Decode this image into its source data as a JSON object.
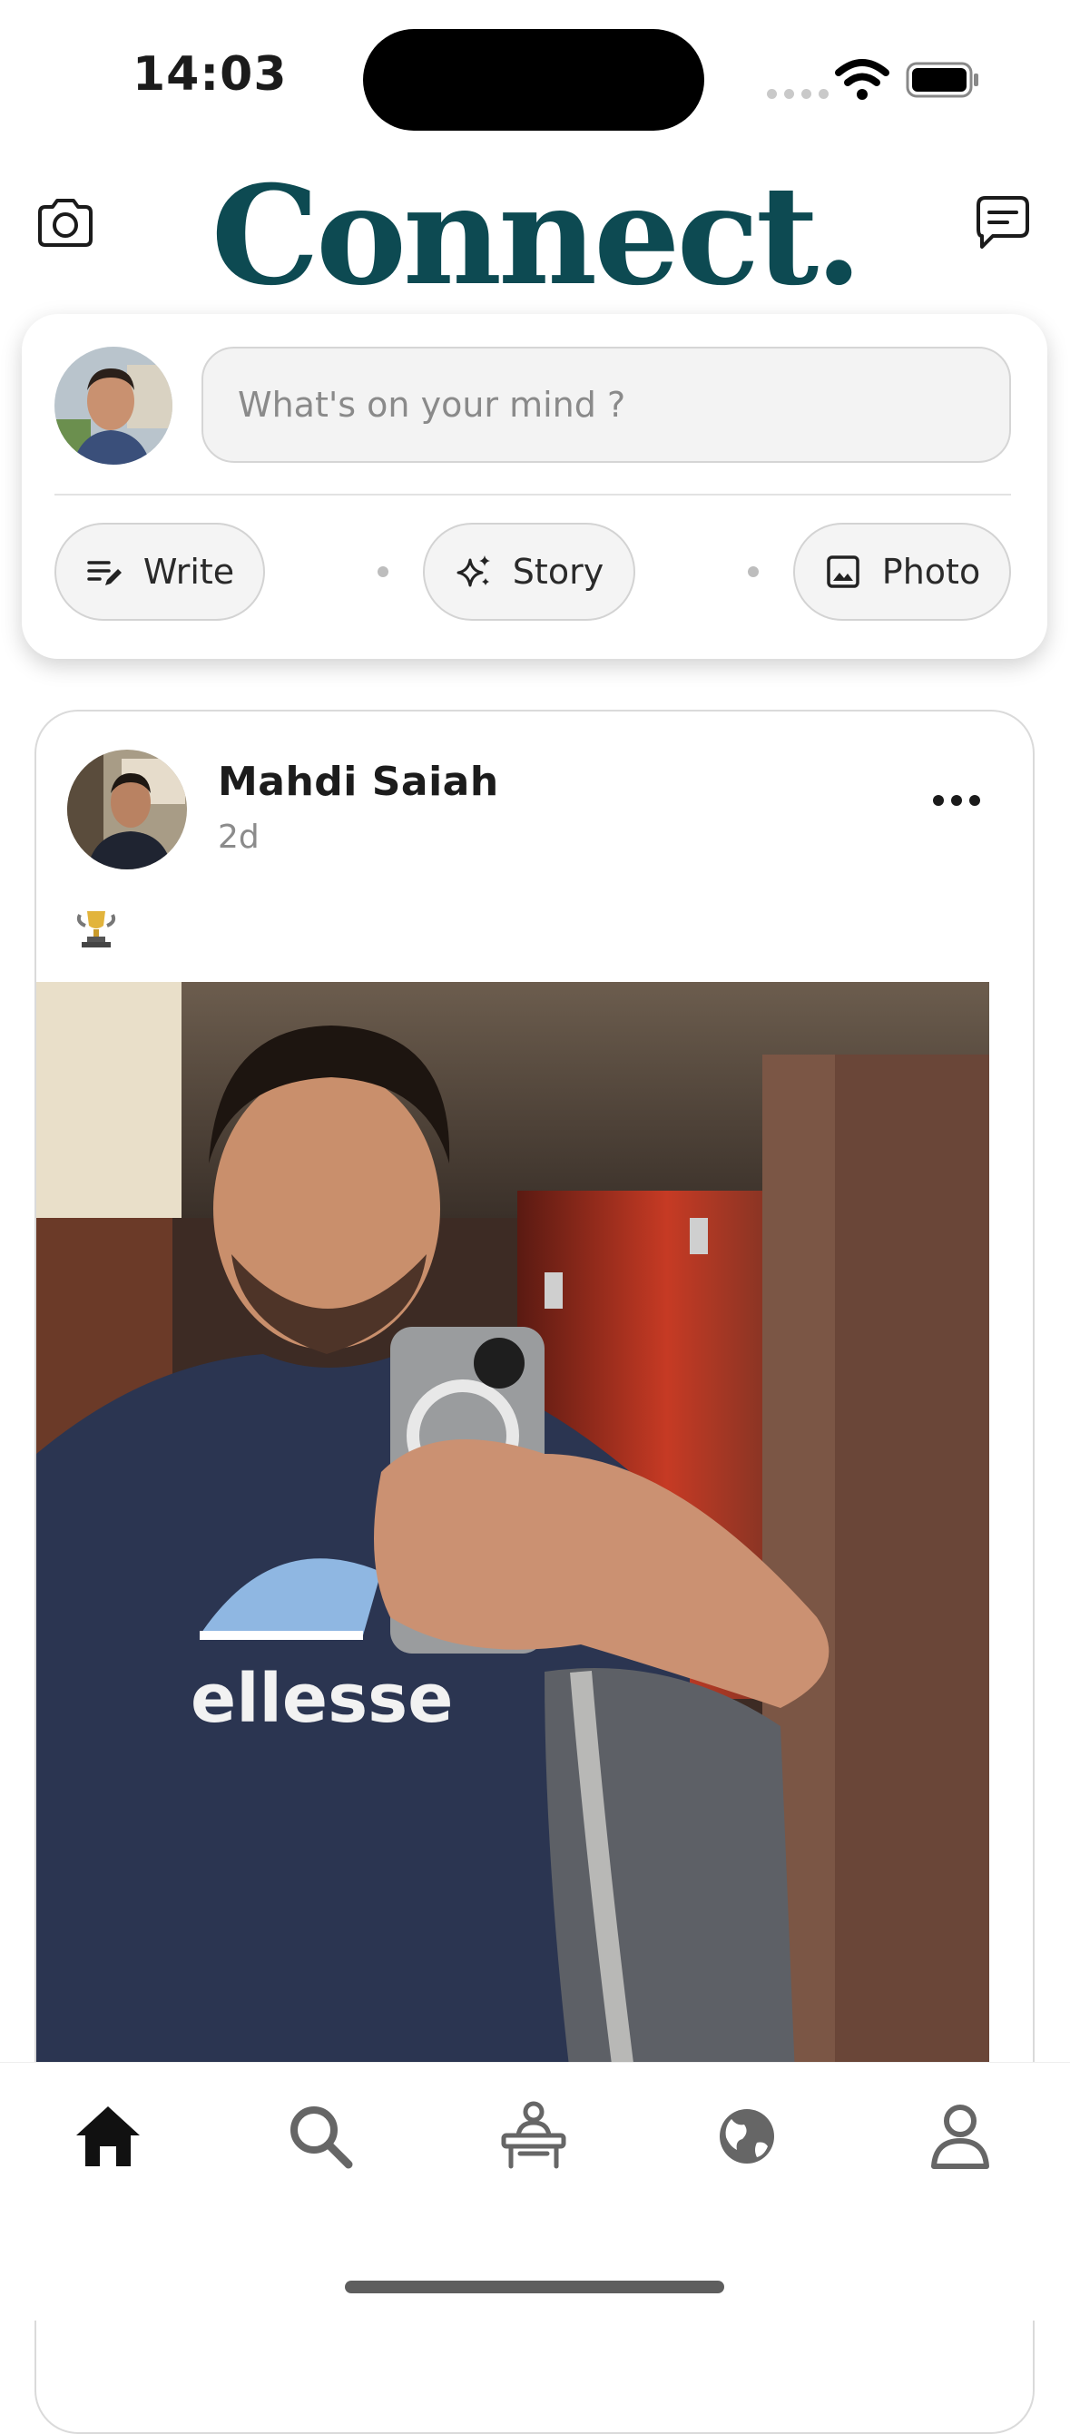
{
  "status_bar": {
    "time": "14:03"
  },
  "header": {
    "title": "Connect.",
    "camera_icon": "camera-icon",
    "messages_icon": "chat-bubble-icon"
  },
  "composer": {
    "placeholder": "What's on your mind ?",
    "actions": [
      {
        "label": "Write",
        "icon": "write-icon"
      },
      {
        "label": "Story",
        "icon": "sparkle-icon"
      },
      {
        "label": "Photo",
        "icon": "image-icon"
      }
    ]
  },
  "post": {
    "author": "Mahdi Saiah",
    "time_ago": "2d",
    "caption_icon": "trophy-emoji",
    "shirt_text": "ellesse"
  },
  "bottom_nav": {
    "items": [
      "home-icon",
      "search-icon",
      "desk-icon",
      "globe-icon",
      "profile-icon"
    ],
    "active": "home-icon"
  },
  "colors": {
    "brand": "#0d4a52",
    "background": "#ffffff",
    "pill_background": "#f4f4f4"
  }
}
